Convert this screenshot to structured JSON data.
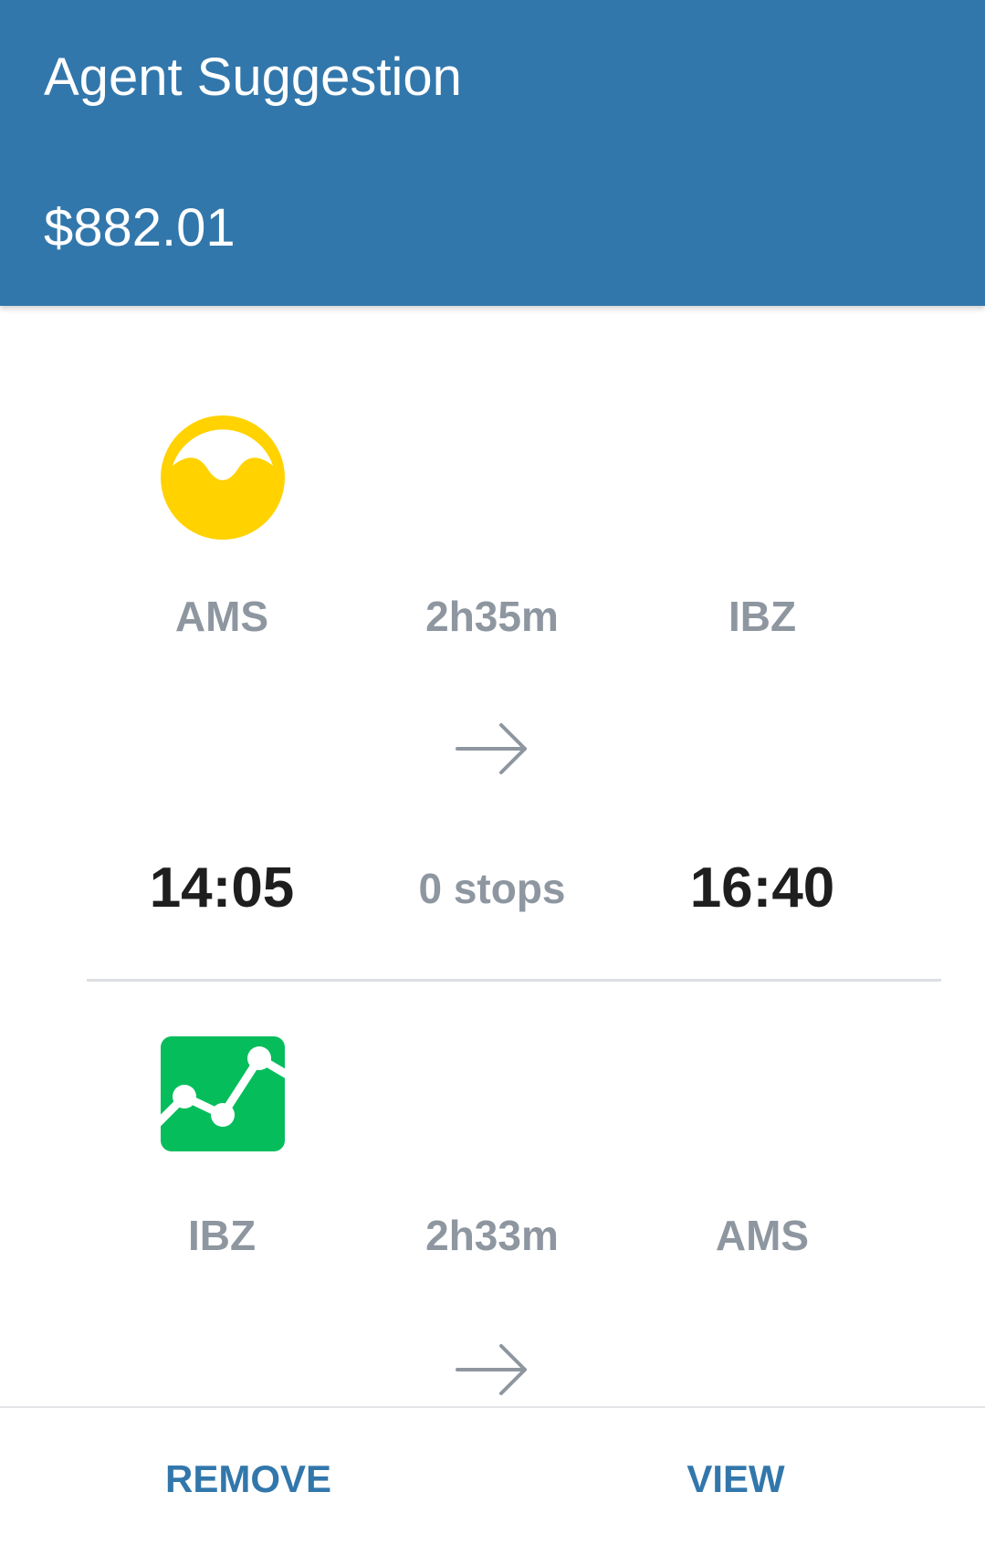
{
  "header": {
    "title": "Agent Suggestion",
    "price": "$882.01"
  },
  "colors": {
    "header_bg": "#3277ab",
    "accent": "#3277ab",
    "airline_1_logo": "#ffd200",
    "airline_2_logo": "#06bd5c",
    "muted_text": "#8e96a0",
    "time_text": "#1e1e1e"
  },
  "legs": [
    {
      "airline_logo_icon": "yellow-wave-circle-logo-icon",
      "origin": "AMS",
      "duration": "2h35m",
      "destination": "IBZ",
      "arrow_icon": "arrow-right-icon",
      "depart_time": "14:05",
      "stops": "0 stops",
      "arrive_time": "16:40"
    },
    {
      "airline_logo_icon": "green-line-chart-logo-icon",
      "origin": "IBZ",
      "duration": "2h33m",
      "destination": "AMS",
      "arrow_icon": "arrow-right-icon"
    }
  ],
  "footer": {
    "remove_label": "REMOVE",
    "view_label": "VIEW"
  }
}
